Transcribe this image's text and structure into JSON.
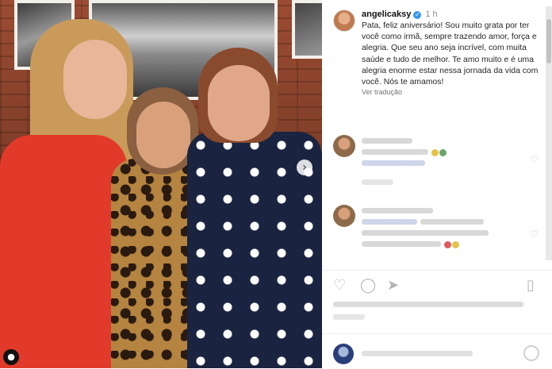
{
  "post": {
    "username": "angelicaksy",
    "time": "1 h",
    "caption": "Pata, feliz aniversário! Sou muito grata por ter você como irmã, sempre trazendo amor, força e alegria. Que seu ano seja incrível, com muita saúde e tudo de melhor. Te amo muito e é uma alegria enorme estar nessa jornada da vida com você. Nós te amamos!",
    "see_translation": "Ver tradução"
  },
  "icons": {
    "verified": "verified-badge-icon",
    "next": "chevron-right-icon",
    "user_tag": "user-icon",
    "like": "heart-icon",
    "comment": "comment-icon",
    "share": "send-icon",
    "save": "bookmark-icon",
    "emoji": "emoji-icon"
  },
  "colors": {
    "verified": "#3897f0",
    "dress_red": "#e23a2a"
  }
}
